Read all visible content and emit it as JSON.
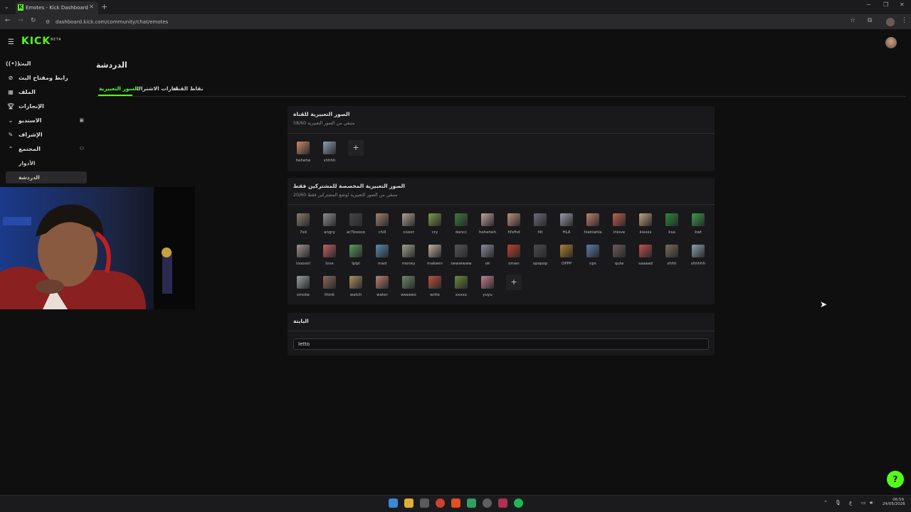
{
  "browser": {
    "tab_title": "Emotes - Kick Dashboard",
    "url": "dashboard.kick.com/community/chat/emotes"
  },
  "app": {
    "logo": "KICK",
    "logo_badge": "BETA"
  },
  "sidebar": {
    "items": [
      {
        "label": "البث",
        "icon": "live-icon"
      },
      {
        "label": "رابط ومفتاح البث",
        "icon": "link-icon"
      },
      {
        "label": "الملف",
        "icon": "folder-icon"
      },
      {
        "label": "الإنجازات",
        "icon": "trophy-icon"
      },
      {
        "label": "الاستديو",
        "icon": "studio-icon"
      },
      {
        "label": "الإشراف",
        "icon": "wrench-icon"
      },
      {
        "label": "المجتمع",
        "icon": "community-icon"
      }
    ],
    "sub_items": [
      {
        "label": "الأدوار"
      },
      {
        "label": "الدردشة"
      }
    ]
  },
  "page": {
    "title": "الدردشة",
    "tabs": [
      "السور التعبيرية",
      "شارات الاشتراك",
      "نقاط القناة"
    ]
  },
  "channel_emotes": {
    "title": "الصور التعبيرية للقناة",
    "subtitle": "58/60 متبقي من الصور التعبيرية",
    "emotes": [
      {
        "name": "hehehe",
        "color": "#c98a6b"
      },
      {
        "name": "shhhh",
        "color": "#8aa0b0"
      }
    ]
  },
  "sub_emotes": {
    "title": "الصور التعبيرية المخصصة للمشتركين فقط",
    "subtitle": "20/60 متبقي من الصور التعبيرية لوضع المشتركين فقط",
    "emotes": [
      {
        "name": "7sd",
        "color": "#8a7a6a"
      },
      {
        "name": "angry",
        "color": "#8c8c8c"
      },
      {
        "name": "ar7boooo",
        "color": "#444444"
      },
      {
        "name": "chill",
        "color": "#a08070"
      },
      {
        "name": "cooot",
        "color": "#b0a090"
      },
      {
        "name": "cry",
        "color": "#7a9a4a"
      },
      {
        "name": "dancc",
        "color": "#3a7a3a"
      },
      {
        "name": "heheheh",
        "color": "#c0a0a0"
      },
      {
        "name": "hfsfhd",
        "color": "#c09080"
      },
      {
        "name": "hlt",
        "color": "#6a6a7a"
      },
      {
        "name": "HLA",
        "color": "#9a9aaa"
      },
      {
        "name": "hlahlahla",
        "color": "#c08070"
      },
      {
        "name": "inlove",
        "color": "#c06050"
      },
      {
        "name": "kiesss",
        "color": "#c0a080"
      },
      {
        "name": "ksa",
        "color": "#2a8a3a"
      },
      {
        "name": "kwt",
        "color": "#3a9a4a"
      },
      {
        "name": "loooool",
        "color": "#a09090"
      },
      {
        "name": "love",
        "color": "#c06060"
      },
      {
        "name": "lplpl",
        "color": "#5a9a5a"
      },
      {
        "name": "mad",
        "color": "#5a8ab0"
      },
      {
        "name": "money",
        "color": "#a0a090"
      },
      {
        "name": "makeen",
        "color": "#c0b0a0"
      },
      {
        "name": "oewwwww",
        "color": "#555555"
      },
      {
        "name": "ok",
        "color": "#8a8a9a"
      },
      {
        "name": "oman",
        "color": "#c04030"
      },
      {
        "name": "opopop",
        "color": "#4a4a4a"
      },
      {
        "name": "OPPP",
        "color": "#b08030"
      },
      {
        "name": "ops",
        "color": "#5a7ab0"
      },
      {
        "name": "qute",
        "color": "#6a5a5a"
      },
      {
        "name": "saaaad",
        "color": "#c05050"
      },
      {
        "name": "shhh",
        "color": "#7a6a5a"
      },
      {
        "name": "shhhhh",
        "color": "#8aa0b0"
      },
      {
        "name": "smoke",
        "color": "#9aa0a0"
      },
      {
        "name": "think",
        "color": "#8a6a5a"
      },
      {
        "name": "watch",
        "color": "#b09060"
      },
      {
        "name": "water",
        "color": "#c08070"
      },
      {
        "name": "weeeeo",
        "color": "#6a8a6a"
      },
      {
        "name": "write",
        "color": "#c05040"
      },
      {
        "name": "xxxxx",
        "color": "#6a8a3a"
      },
      {
        "name": "yuyu",
        "color": "#c08090"
      }
    ]
  },
  "blocked": {
    "title": "البايتة",
    "input_value": "letto"
  },
  "taskbar": {
    "time": "06:59",
    "date": "24/05/2026",
    "lang": "ع"
  },
  "colors": {
    "accent": "#53fc18",
    "bg": "#0f0f10",
    "panel": "#19191b"
  }
}
